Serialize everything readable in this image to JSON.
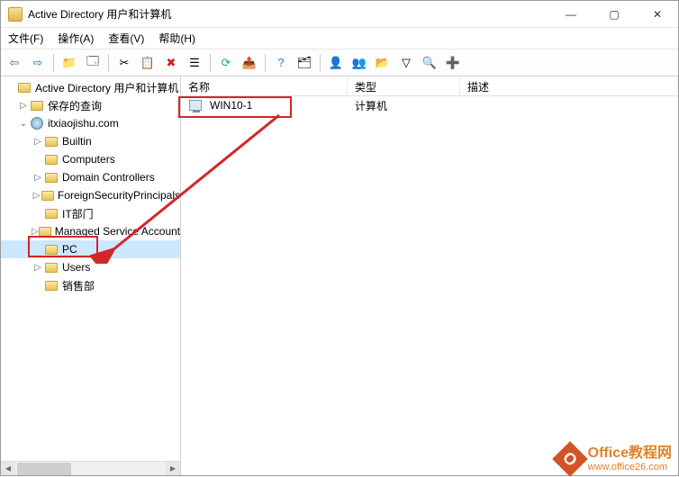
{
  "titlebar": {
    "title": "Active Directory 用户和计算机"
  },
  "menu": {
    "file": "文件(F)",
    "action": "操作(A)",
    "view": "查看(V)",
    "help": "帮助(H)"
  },
  "tree": {
    "root": "Active Directory 用户和计算机",
    "saved_queries": "保存的查询",
    "domain": "itxiaojishu.com",
    "builtin": "Builtin",
    "computers": "Computers",
    "dc": "Domain Controllers",
    "fsp": "ForeignSecurityPrincipals",
    "itdept": "IT部门",
    "msa": "Managed Service Accounts",
    "pc": "PC",
    "users": "Users",
    "sales": "销售部"
  },
  "list": {
    "col_name": "名称",
    "col_type": "类型",
    "col_desc": "描述",
    "items": [
      {
        "name": "WIN10-1",
        "type": "计算机",
        "desc": ""
      }
    ]
  },
  "watermark": {
    "title": "Office教程网",
    "url": "www.office26.com"
  }
}
